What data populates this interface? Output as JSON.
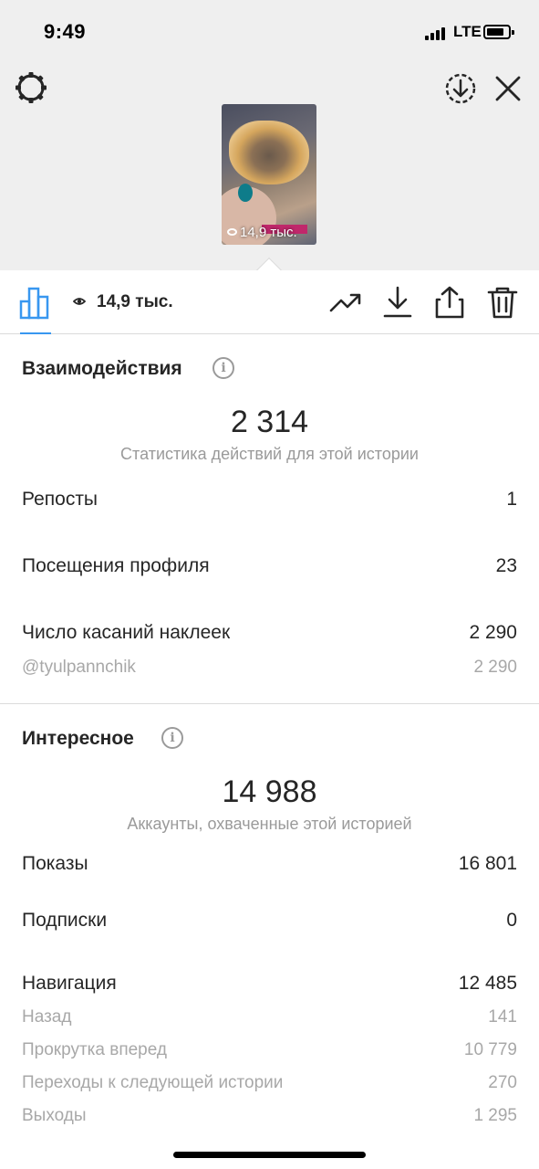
{
  "status_bar": {
    "time": "9:49",
    "network": "LTE"
  },
  "header": {
    "settings_icon": "gear-icon",
    "save_icon": "download-circle-icon",
    "close_icon": "close-icon",
    "thumbnail_views": "14,9 тыс."
  },
  "toolbar": {
    "insights_icon": "bar-chart-icon",
    "views_count": "14,9 тыс.",
    "actions": [
      "trend-icon",
      "download-icon",
      "share-icon",
      "trash-icon"
    ],
    "accent_color": "#3897f0"
  },
  "interactions": {
    "title": "Взаимодействия",
    "total": "2 314",
    "subtitle": "Статистика действий для этой истории",
    "rows": [
      {
        "label": "Репосты",
        "value": "1"
      },
      {
        "label": "Посещения профиля",
        "value": "23"
      },
      {
        "label": "Число касаний наклеек",
        "value": "2 290"
      }
    ],
    "sticker_handle": {
      "label": "@tyulpannchik",
      "value": "2 290"
    }
  },
  "discovery": {
    "title": "Интересное",
    "total": "14 988",
    "subtitle": "Аккаунты, охваченные этой историей",
    "rows": [
      {
        "label": "Показы",
        "value": "16 801"
      },
      {
        "label": "Подписки",
        "value": "0"
      },
      {
        "label": "Навигация",
        "value": "12 485"
      }
    ],
    "navigation_breakdown": [
      {
        "label": "Назад",
        "value": "141"
      },
      {
        "label": "Прокрутка вперед",
        "value": "10 779"
      },
      {
        "label": "Переходы к следующей истории",
        "value": "270"
      },
      {
        "label": "Выходы",
        "value": "1 295"
      }
    ]
  }
}
